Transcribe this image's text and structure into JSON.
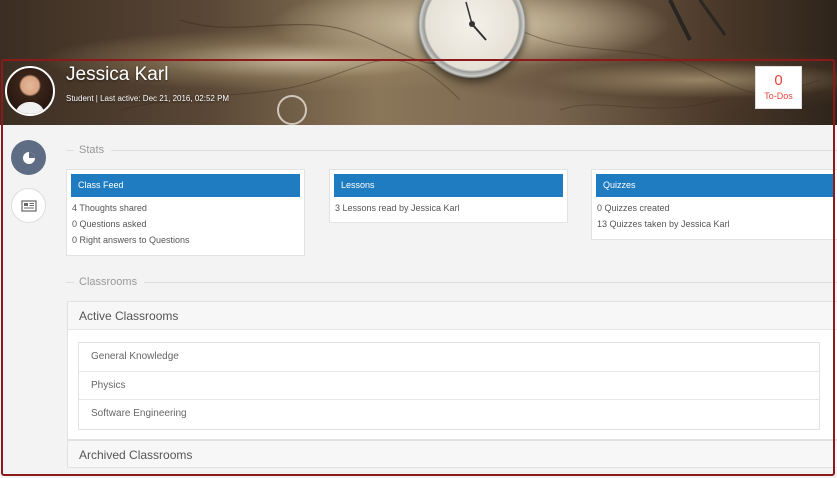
{
  "profile": {
    "name": "Jessica Karl",
    "meta": "Student | Last active: Dec 21, 2016, 02:52 PM"
  },
  "todos": {
    "count": "0",
    "label": "To-Dos"
  },
  "sections": {
    "stats": "Stats",
    "classrooms": "Classrooms"
  },
  "stats": {
    "class_feed": {
      "title": "Class Feed",
      "lines": [
        "4 Thoughts shared",
        "0 Questions asked",
        "0 Right answers to Questions"
      ]
    },
    "lessons": {
      "title": "Lessons",
      "lines": [
        "3 Lessons read by Jessica Karl"
      ]
    },
    "quizzes": {
      "title": "Quizzes",
      "lines": [
        "0 Quizzes created",
        "13 Quizzes taken by Jessica Karl"
      ]
    }
  },
  "active_classrooms": {
    "title": "Active Classrooms",
    "items": [
      "General Knowledge",
      "Physics",
      "Software Engineering"
    ]
  },
  "archived_classrooms": {
    "title": "Archived Classrooms"
  },
  "icons": {
    "side_active": "pie-chart-icon",
    "side_inactive": "newspaper-icon"
  },
  "colors": {
    "accent": "#1f7cc1",
    "todo": "#e8453c",
    "frame": "#8b1a1a",
    "side_active": "#5e6c84"
  }
}
